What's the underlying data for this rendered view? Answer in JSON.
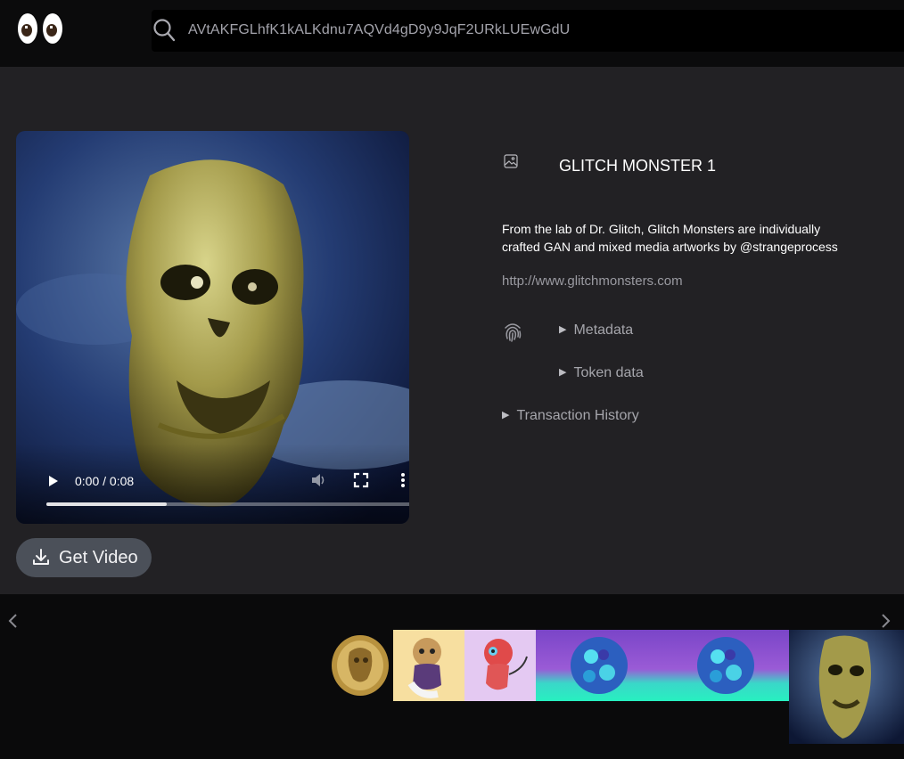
{
  "header": {
    "logo_icon": "eyes-icon",
    "search_icon": "search-icon",
    "search_value": "AVtAKFGLhfK1kALKdnu7AQVd4gD9y9JqF2URkLUEwGdU"
  },
  "media": {
    "type": "video",
    "time_display": "0:00 / 0:08",
    "progress_fraction": 0.33,
    "controls": {
      "play_icon": "play-icon",
      "volume_icon": "volume-icon",
      "fullscreen_icon": "fullscreen-icon",
      "more_icon": "more-vertical-icon"
    },
    "get_video_label": "Get Video",
    "download_icon": "download-icon"
  },
  "nft": {
    "type_icon": "image-icon",
    "title": "GLITCH MONSTER 1",
    "description": "From the lab of Dr. Glitch, Glitch Monsters are individually crafted GAN and mixed media artworks by @strangeprocess",
    "external_url": "http://www.glitchmonsters.com",
    "fingerprint_icon": "fingerprint-icon",
    "metadata_label": "Metadata",
    "token_data_label": "Token data",
    "transaction_history_label": "Transaction History"
  },
  "carousel": {
    "prev_icon": "chevron-left-icon",
    "next_icon": "chevron-right-icon",
    "items": [
      {
        "name": "thumb-gold-coin",
        "bg": "#0a0a0b"
      },
      {
        "name": "thumb-voodoo-doll",
        "bg": "#f7dfa0"
      },
      {
        "name": "thumb-red-creature",
        "bg": "#e4c9f2"
      },
      {
        "name": "thumb-glitch-sphere",
        "bg": "#8a4fd0"
      },
      {
        "name": "thumb-glitch-sphere-2",
        "bg": "#8a4fd0"
      },
      {
        "name": "thumb-glitch-monster",
        "bg": "#2a3d5a"
      }
    ]
  }
}
